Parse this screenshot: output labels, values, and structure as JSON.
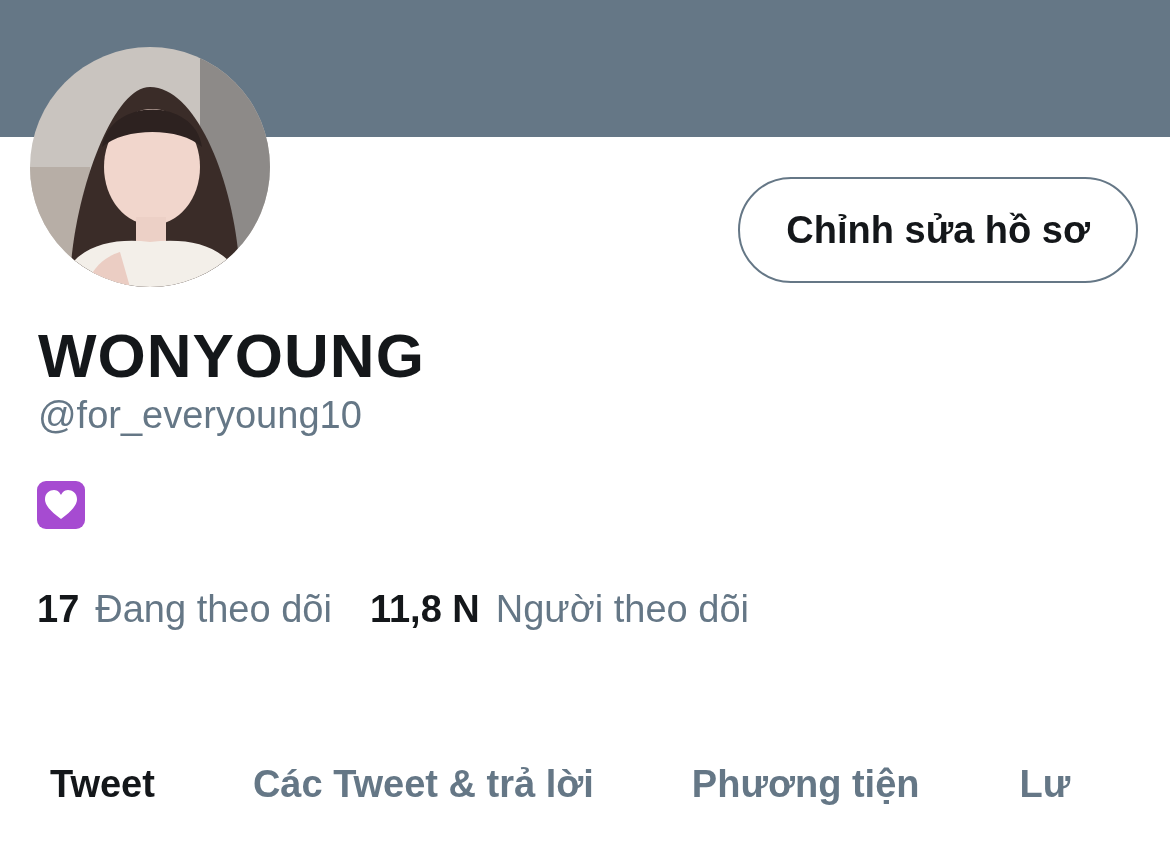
{
  "profile": {
    "edit_button": "Chỉnh sửa hồ sơ",
    "name": "WONYOUNG",
    "handle": "@for_everyoung10"
  },
  "stats": [
    {
      "count": "17",
      "label": "Đang theo dõi"
    },
    {
      "count": "11,8 N",
      "label": "Người theo dõi"
    }
  ],
  "tabs": [
    {
      "label": "Tweet",
      "selected": true
    },
    {
      "label": "Các Tweet & trả lời",
      "selected": false
    },
    {
      "label": "Phương tiện",
      "selected": false
    },
    {
      "label": "Lư",
      "selected": false
    }
  ]
}
